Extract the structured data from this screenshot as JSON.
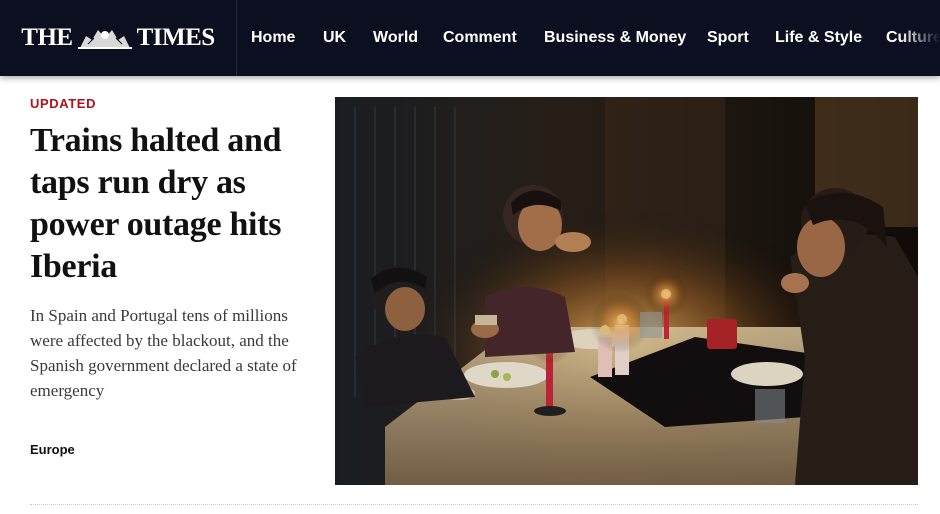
{
  "brand": {
    "left": "THE",
    "right": "TIMES",
    "crest_icon": "royal-crest-icon"
  },
  "nav": {
    "items": [
      {
        "label": "Home"
      },
      {
        "label": "UK"
      },
      {
        "label": "World"
      },
      {
        "label": "Comment"
      },
      {
        "label": "Business & Money"
      },
      {
        "label": "Sport"
      },
      {
        "label": "Life & Style"
      },
      {
        "label": "Culture"
      }
    ]
  },
  "article": {
    "tag": "UPDATED",
    "headline": "Trains halted and taps run dry as power outage hits Iberia",
    "standfirst": "In Spain and Portugal tens of millions were affected by the blackout, and the Spanish government declared a state of emergency",
    "section": "Europe"
  },
  "colors": {
    "masthead": "#0b0f1f",
    "tag_red": "#b0131b",
    "headline": "#111111",
    "candle_glow": "#ffb347"
  }
}
